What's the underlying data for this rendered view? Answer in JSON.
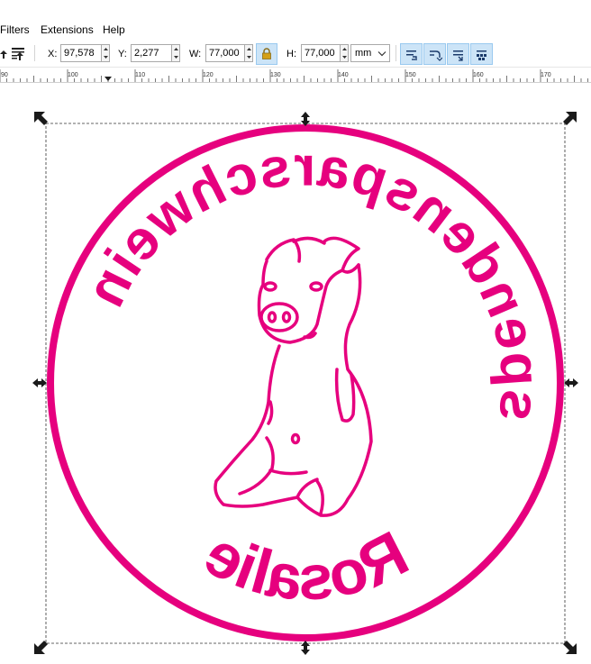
{
  "menubar": {
    "items": [
      "Filters",
      "Extensions",
      "Help"
    ]
  },
  "toolbar": {
    "x_label": "X:",
    "x_value": "97,578",
    "y_label": "Y:",
    "y_value": "2,277",
    "w_label": "W:",
    "w_value": "77,000",
    "h_label": "H:",
    "h_value": "77,000",
    "unit": "mm"
  },
  "ruler": {
    "labels": [
      "90",
      "100",
      "110",
      "120",
      "130",
      "140",
      "150",
      "160",
      "170"
    ]
  },
  "artwork": {
    "top_text": "spendenspar",
    "bottom_text": "Rosalie",
    "left_text": "schwein",
    "color": "#e6007e"
  },
  "colors": {
    "accent": "#e6007e",
    "toggle_bg": "#cce4f7",
    "toggle_border": "#99c9ef"
  }
}
